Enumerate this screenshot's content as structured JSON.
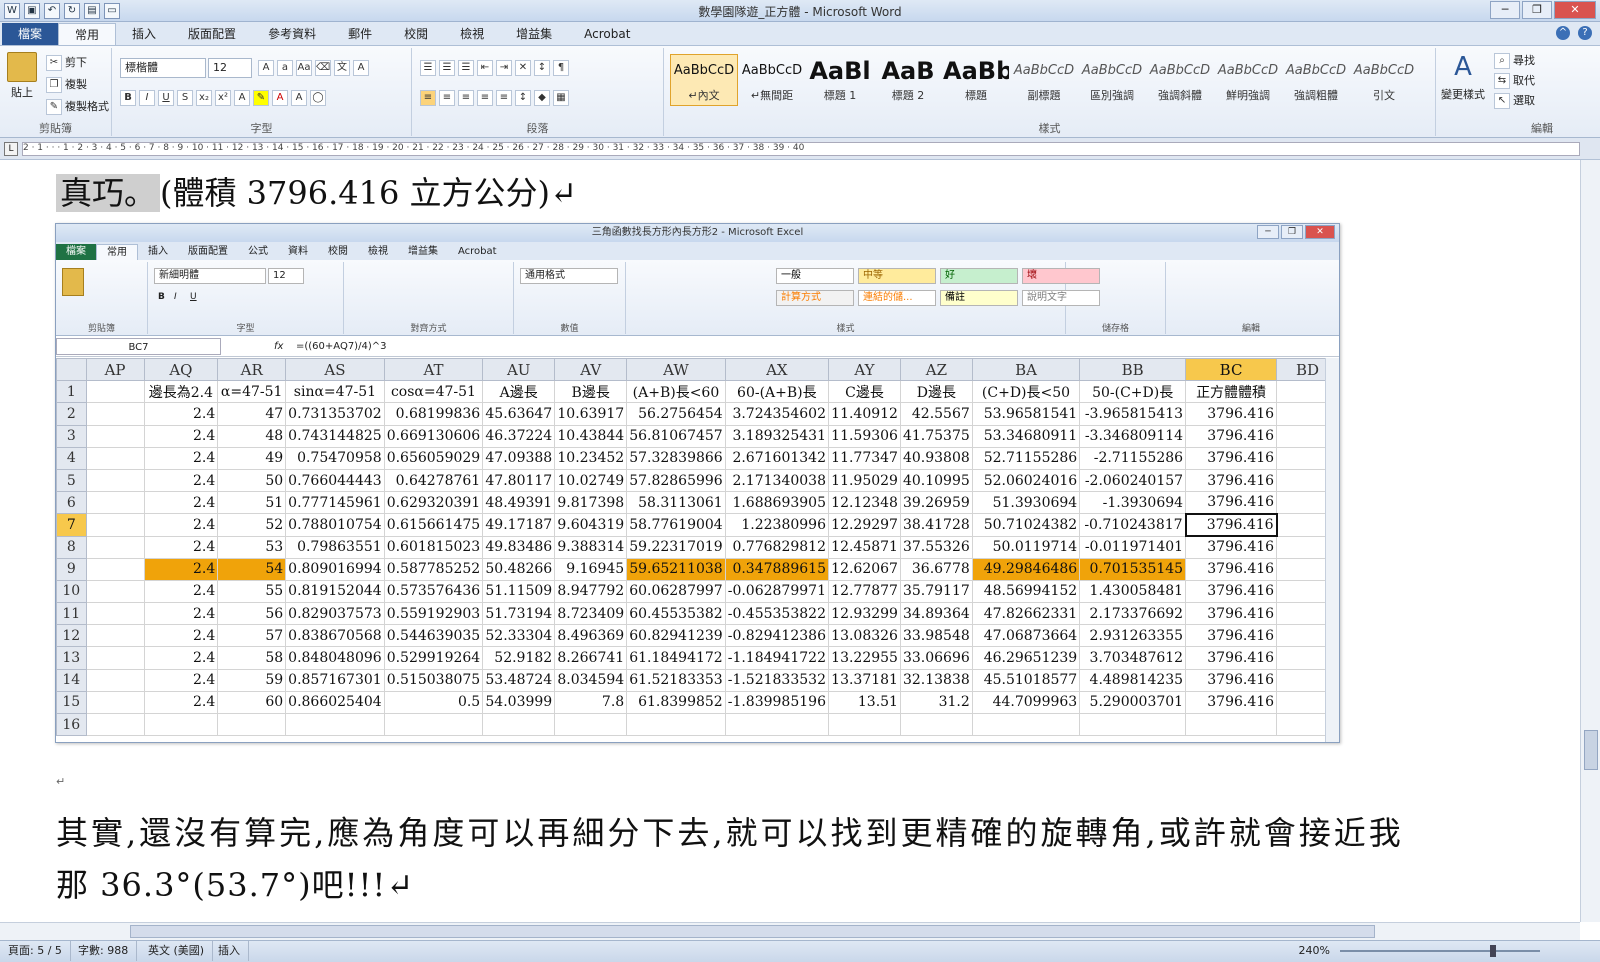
{
  "word": {
    "title": "數學園隊遊_正方體 - Microsoft Word",
    "tabs": [
      "檔案",
      "常用",
      "插入",
      "版面配置",
      "參考資料",
      "郵件",
      "校閱",
      "檢視",
      "增益集",
      "Acrobat"
    ],
    "clipboard": {
      "paste": "貼上",
      "cut": "剪下",
      "copy": "複製",
      "format_painter": "複製格式",
      "label": "剪貼簿"
    },
    "font": {
      "name": "標楷體",
      "size": "12",
      "label": "字型"
    },
    "paragraph_label": "段落",
    "styles": [
      {
        "preview": "AaBbCcD",
        "name": "↵內文"
      },
      {
        "preview": "AaBbCcD",
        "name": "↵無間距"
      },
      {
        "preview": "AaBl",
        "name": "標題 1"
      },
      {
        "preview": "AaB",
        "name": "標題 2"
      },
      {
        "preview": "AaBbC",
        "name": "標題"
      },
      {
        "preview": "AaBbCcD",
        "name": "副標題"
      },
      {
        "preview": "AaBbCcD",
        "name": "區別強調"
      },
      {
        "preview": "AaBbCcD",
        "name": "強調斜體"
      },
      {
        "preview": "AaBbCcD",
        "name": "鮮明強調"
      },
      {
        "preview": "AaBbCcD",
        "name": "強調粗體"
      },
      {
        "preview": "AaBbCcD",
        "name": "引文"
      }
    ],
    "styles_label": "樣式",
    "change_styles": "變更樣式",
    "editing": {
      "find": "尋找",
      "replace": "取代",
      "select": "選取",
      "label": "編輯"
    },
    "ruler": "2 · 1 · · · 1 · 2 · 3 · 4 · 5 · 6 · 7 · 8 · 9 · 10 · 11 · 12 · 13 · 14 · 15 · 16 · 17 · 18 · 19 · 20 · 21 · 22 · 23 · 24 · 25 · 26 · 27 · 28 · 29 · 30 · 31 · 32 · 33 · 34 · 35 · 36 · 37 · 38 · 39 · 40",
    "doc_line1_hl": "真巧。",
    "doc_line1_rest": "(體積 3796.416 立方公分)↵",
    "para1": "其實,還沒有算完,應為角度可以再細分下去,就可以找到更精確的旋轉角,或許就會接近我",
    "para2": "那 36.3°(53.7°)吧!!!↵",
    "para_mark": "↵",
    "status": {
      "page": "頁面: 5 / 5",
      "words": "字數: 988",
      "lang": "英文 (美國)",
      "mode": "插入",
      "zoom": "240%"
    }
  },
  "excel": {
    "title": "三角函數找長方形內長方形2 - Microsoft Excel",
    "tabs": [
      "檔案",
      "常用",
      "插入",
      "版面配置",
      "公式",
      "資料",
      "校閱",
      "檢視",
      "增益集",
      "Acrobat"
    ],
    "font_name": "新細明體",
    "font_size": "12",
    "number_format": "通用格式",
    "groups": [
      "剪貼簿",
      "字型",
      "對齊方式",
      "數值",
      "樣式",
      "儲存格",
      "編輯"
    ],
    "cell_styles": [
      {
        "name": "一般",
        "bg": "#ffffff",
        "fg": "#000000"
      },
      {
        "name": "中等",
        "bg": "#ffeb9c",
        "fg": "#9c6500"
      },
      {
        "name": "好",
        "bg": "#c6efce",
        "fg": "#006100"
      },
      {
        "name": "壞",
        "bg": "#ffc7ce",
        "fg": "#9c0006"
      },
      {
        "name": "計算方式",
        "bg": "#f2f2f2",
        "fg": "#fa7d00"
      },
      {
        "name": "連結的儲...",
        "bg": "#ffffff",
        "fg": "#fa7d00"
      },
      {
        "name": "備註",
        "bg": "#ffffcc",
        "fg": "#000000"
      },
      {
        "name": "說明文字",
        "bg": "#ffffff",
        "fg": "#7f7f7f"
      }
    ],
    "name_box": "BC7",
    "formula": "=((60+AQ7)/4)^3",
    "fx": "fx",
    "columns": [
      "AP",
      "AQ",
      "AR",
      "AS",
      "AT",
      "AU",
      "AV",
      "AW",
      "AX",
      "AY",
      "AZ",
      "BA",
      "BB",
      "BC",
      "BD"
    ],
    "selected_column": "BC",
    "selected_row": "7",
    "highlight_color": "#f0a30a",
    "header_row": [
      "",
      "邊長為2.4",
      "α=47-51",
      "sinα=47-51",
      "cosα=47-51",
      "A邊長",
      "B邊長",
      "(A+B)長<60",
      "60-(A+B)長",
      "C邊長",
      "D邊長",
      "(C+D)長<50",
      "50-(C+D)長",
      "正方體體積",
      ""
    ],
    "rows": [
      {
        "n": "2",
        "c": [
          "",
          "2.4",
          "47",
          "0.731353702",
          "0.68199836",
          "45.63647",
          "10.63917",
          "56.2756454",
          "3.724354602",
          "11.40912",
          "42.5567",
          "53.96581541",
          "-3.965815413",
          "3796.416",
          ""
        ]
      },
      {
        "n": "3",
        "c": [
          "",
          "2.4",
          "48",
          "0.743144825",
          "0.669130606",
          "46.37224",
          "10.43844",
          "56.81067457",
          "3.189325431",
          "11.59306",
          "41.75375",
          "53.34680911",
          "-3.346809114",
          "3796.416",
          ""
        ]
      },
      {
        "n": "4",
        "c": [
          "",
          "2.4",
          "49",
          "0.75470958",
          "0.656059029",
          "47.09388",
          "10.23452",
          "57.32839866",
          "2.671601342",
          "11.77347",
          "40.93808",
          "52.71155286",
          "-2.71155286",
          "3796.416",
          ""
        ]
      },
      {
        "n": "5",
        "c": [
          "",
          "2.4",
          "50",
          "0.766044443",
          "0.64278761",
          "47.80117",
          "10.02749",
          "57.82865996",
          "2.171340038",
          "11.95029",
          "40.10995",
          "52.06024016",
          "-2.060240157",
          "3796.416",
          ""
        ]
      },
      {
        "n": "6",
        "c": [
          "",
          "2.4",
          "51",
          "0.777145961",
          "0.629320391",
          "48.49391",
          "9.817398",
          "58.3113061",
          "1.688693905",
          "12.12348",
          "39.26959",
          "51.3930694",
          "-1.3930694",
          "3796.416",
          ""
        ]
      },
      {
        "n": "7",
        "c": [
          "",
          "2.4",
          "52",
          "0.788010754",
          "0.615661475",
          "49.17187",
          "9.604319",
          "58.77619004",
          "1.22380996",
          "12.29297",
          "38.41728",
          "50.71024382",
          "-0.710243817",
          "3796.416",
          ""
        ]
      },
      {
        "n": "8",
        "c": [
          "",
          "2.4",
          "53",
          "0.79863551",
          "0.601815023",
          "49.83486",
          "9.388314",
          "59.22317019",
          "0.776829812",
          "12.45871",
          "37.55326",
          "50.0119714",
          "-0.011971401",
          "3796.416",
          ""
        ]
      },
      {
        "n": "9",
        "c": [
          "",
          "2.4",
          "54",
          "0.809016994",
          "0.587785252",
          "50.48266",
          "9.16945",
          "59.65211038",
          "0.347889615",
          "12.62067",
          "36.6778",
          "49.29846486",
          "0.701535145",
          "3796.416",
          ""
        ],
        "hl": [
          1,
          2,
          7,
          8,
          11,
          12
        ]
      },
      {
        "n": "10",
        "c": [
          "",
          "2.4",
          "55",
          "0.819152044",
          "0.573576436",
          "51.11509",
          "8.947792",
          "60.06287997",
          "-0.062879971",
          "12.77877",
          "35.79117",
          "48.56994152",
          "1.430058481",
          "3796.416",
          ""
        ]
      },
      {
        "n": "11",
        "c": [
          "",
          "2.4",
          "56",
          "0.829037573",
          "0.559192903",
          "51.73194",
          "8.723409",
          "60.45535382",
          "-0.455353822",
          "12.93299",
          "34.89364",
          "47.82662331",
          "2.173376692",
          "3796.416",
          ""
        ]
      },
      {
        "n": "12",
        "c": [
          "",
          "2.4",
          "57",
          "0.838670568",
          "0.544639035",
          "52.33304",
          "8.496369",
          "60.82941239",
          "-0.829412386",
          "13.08326",
          "33.98548",
          "47.06873664",
          "2.931263355",
          "3796.416",
          ""
        ]
      },
      {
        "n": "13",
        "c": [
          "",
          "2.4",
          "58",
          "0.848048096",
          "0.529919264",
          "52.9182",
          "8.266741",
          "61.18494172",
          "-1.184941722",
          "13.22955",
          "33.06696",
          "46.29651239",
          "3.703487612",
          "3796.416",
          ""
        ]
      },
      {
        "n": "14",
        "c": [
          "",
          "2.4",
          "59",
          "0.857167301",
          "0.515038075",
          "53.48724",
          "8.034594",
          "61.52183353",
          "-1.521833532",
          "13.37181",
          "32.13838",
          "45.51018577",
          "4.489814235",
          "3796.416",
          ""
        ]
      },
      {
        "n": "15",
        "c": [
          "",
          "2.4",
          "60",
          "0.866025404",
          "0.5",
          "54.03999",
          "7.8",
          "61.8399852",
          "-1.839985196",
          "13.51",
          "31.2",
          "44.7099963",
          "5.290003701",
          "3796.416",
          ""
        ]
      },
      {
        "n": "16",
        "c": [
          "",
          "",
          "",
          "",
          "",
          "",
          "",
          "",
          "",
          "",
          "",
          "",
          "",
          "",
          ""
        ]
      }
    ]
  }
}
